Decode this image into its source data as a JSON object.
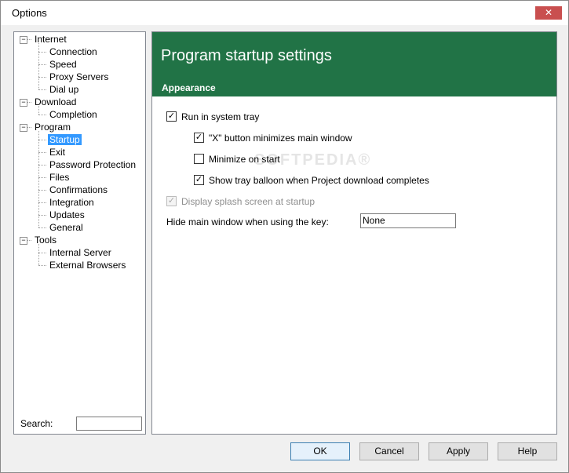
{
  "window": {
    "title": "Options",
    "close_glyph": "✕"
  },
  "tree": {
    "items": [
      {
        "label": "Internet",
        "level": 0,
        "expanded": true
      },
      {
        "label": "Connection",
        "level": 1
      },
      {
        "label": "Speed",
        "level": 1
      },
      {
        "label": "Proxy Servers",
        "level": 1
      },
      {
        "label": "Dial up",
        "level": 1
      },
      {
        "label": "Download",
        "level": 0,
        "expanded": true
      },
      {
        "label": "Completion",
        "level": 1
      },
      {
        "label": "Program",
        "level": 0,
        "expanded": true
      },
      {
        "label": "Startup",
        "level": 1,
        "selected": true
      },
      {
        "label": "Exit",
        "level": 1
      },
      {
        "label": "Password Protection",
        "level": 1
      },
      {
        "label": "Files",
        "level": 1
      },
      {
        "label": "Confirmations",
        "level": 1
      },
      {
        "label": "Integration",
        "level": 1
      },
      {
        "label": "Updates",
        "level": 1
      },
      {
        "label": "General",
        "level": 1
      },
      {
        "label": "Tools",
        "level": 0,
        "expanded": true
      },
      {
        "label": "Internal Server",
        "level": 1
      },
      {
        "label": "External Browsers",
        "level": 1
      }
    ],
    "search_label": "Search:",
    "search_value": ""
  },
  "panel": {
    "title": "Program startup settings",
    "section": "Appearance",
    "header_color": "#217346",
    "options": {
      "run_in_tray": {
        "label": "Run in system tray",
        "checked": true
      },
      "x_minimizes": {
        "label": "\"X\" button minimizes main window",
        "checked": true
      },
      "minimize_on_start": {
        "label": "Minimize on start",
        "checked": false
      },
      "tray_balloon": {
        "label": "Show tray balloon when Project download completes",
        "checked": true
      },
      "splash": {
        "label": "Display splash screen at startup",
        "checked": true,
        "disabled": true
      }
    },
    "hide_label": "Hide main window when using the key:",
    "hide_value": "None"
  },
  "buttons": {
    "ok": "OK",
    "cancel": "Cancel",
    "apply": "Apply",
    "help": "Help"
  }
}
